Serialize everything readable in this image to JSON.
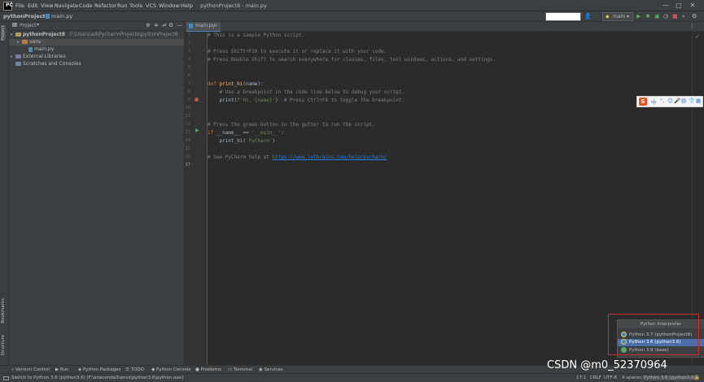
{
  "menubar": {
    "items": [
      "File",
      "Edit",
      "View",
      "Navigate",
      "Code",
      "Refactor",
      "Run",
      "Tools",
      "VCS",
      "Window",
      "Help"
    ],
    "window_title": "pythonProject8 - main.py",
    "minimize": "—",
    "maximize": "□",
    "close": "✕"
  },
  "navbar": {
    "project": "pythonProject8",
    "separator": "›",
    "file": "main.py",
    "run_config": "main"
  },
  "project_panel": {
    "title": "Project",
    "items": [
      {
        "name": "pythonProject8",
        "path": "F:\\Users\\ad\\PycharmProjects\\pythonProject8"
      },
      {
        "name": "venv"
      },
      {
        "name": "main.py"
      },
      {
        "name": "External Libraries"
      },
      {
        "name": "Scratches and Consoles"
      }
    ],
    "side_tabs": [
      "Project",
      "Bookmarks",
      "Structure"
    ]
  },
  "editor": {
    "tab": "main.py",
    "lines": [
      "1",
      "2",
      "3",
      "4",
      "5",
      "6",
      "7",
      "8",
      "9",
      "10",
      "11",
      "12",
      "13",
      "14",
      "15",
      "16",
      "17"
    ],
    "code": {
      "l1": "# This is a sample Python script.",
      "l3": "# Press Shift+F10 to execute it or replace it with your code.",
      "l4": "# Press Double Shift to search everywhere for classes, files, tool windows, actions, and settings.",
      "l7_kw": "def ",
      "l7_fn": "print_hi",
      "l7_rest": "(name):",
      "l8": "    # Use a breakpoint in the code line below to debug your script.",
      "l9_a": "    print(",
      "l9_str": "f'Hi, {name}'",
      "l9_b": ")  ",
      "l9_cmt": "# Press Ctrl+F8 to toggle the breakpoint.",
      "l12": "# Press the green button in the gutter to run the script.",
      "l13_kw": "if ",
      "l13_a": "__name__ == ",
      "l13_str": "'__main__'",
      "l13_b": ":",
      "l14_a": "    print_hi(",
      "l14_str": "'PyCharm'",
      "l14_b": ")",
      "l16_cmt": "# See PyCharm help at ",
      "l16_link": "https://www.jetbrains.com/help/pycharm/"
    }
  },
  "ime": {
    "logo": "S",
    "icons": [
      "中",
      "°,",
      "☺",
      "🎤",
      "▤",
      "👕",
      "▦"
    ]
  },
  "interpreter_popup": {
    "title": "Python Interpreter",
    "items": [
      "Python 3.7 (pythonProject8)",
      "Python 3.6 (python3.6)",
      "Python 3.9 (base)"
    ],
    "selected_index": 1
  },
  "tool_windows": [
    "Version Control",
    "Run",
    "Python Packages",
    "TODO",
    "Python Console",
    "Problems",
    "Terminal",
    "Services"
  ],
  "statusbar": {
    "message": "Switch to Python 3.6 (python3.6) [F:\\anaconda3\\envs\\python3.6\\python.exe]",
    "position": "17:1",
    "line_sep": "CRLF",
    "encoding": "UTF-8",
    "indent": "4 spaces",
    "interpreter": "Python 3.6 (python3.6)"
  },
  "watermark": "CSDN @m0_52370964",
  "colors": {
    "accent": "#4a88c7",
    "breakpoint": "#c75450",
    "highlight_box": "#d12a2a",
    "selection": "#4a6ea8"
  }
}
